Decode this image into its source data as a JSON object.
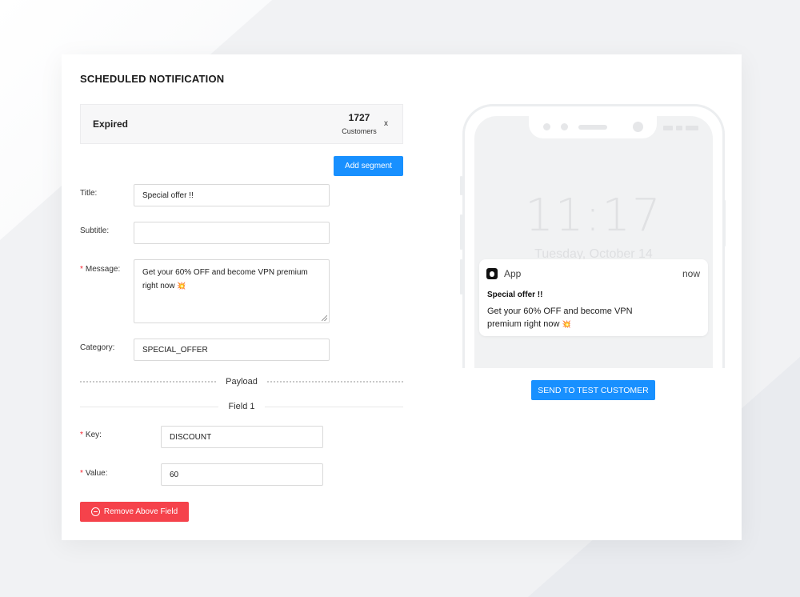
{
  "heading": "SCHEDULED NOTIFICATION",
  "segment": {
    "name": "Expired",
    "count": "1727",
    "unit": "Customers",
    "close": "x"
  },
  "add_segment_label": "Add segment",
  "form": {
    "title_label": "Title",
    "title_value": "Special offer !!",
    "subtitle_label": "Subtitle",
    "subtitle_value": "",
    "message_label": "Message",
    "message_value": "Get your 60% OFF and become VPN premium right now",
    "category_label": "Category",
    "category_value": "SPECIAL_OFFER",
    "required_mark": "*",
    "colon": ":"
  },
  "payload": {
    "heading": "Payload",
    "field_heading": "Field 1",
    "key_label": "Key",
    "key_value": "DISCOUNT",
    "value_label": "Value",
    "value_value": "60",
    "remove_label": "Remove Above Field"
  },
  "preview": {
    "clock": "11:17",
    "date": "Tuesday, October 14",
    "app_name": "App",
    "time": "now",
    "title": "Special offer !!",
    "body": "Get your 60% OFF and become VPN premium right now",
    "emoji": "💥"
  },
  "send_test_label": "SEND TO TEST CUSTOMER",
  "colors": {
    "primary": "#1890ff",
    "danger": "#f5424b",
    "required": "#f5222d"
  },
  "icons": {
    "segment_close": "close-icon",
    "remove": "minus-circle-icon",
    "app": "apple-icon"
  }
}
